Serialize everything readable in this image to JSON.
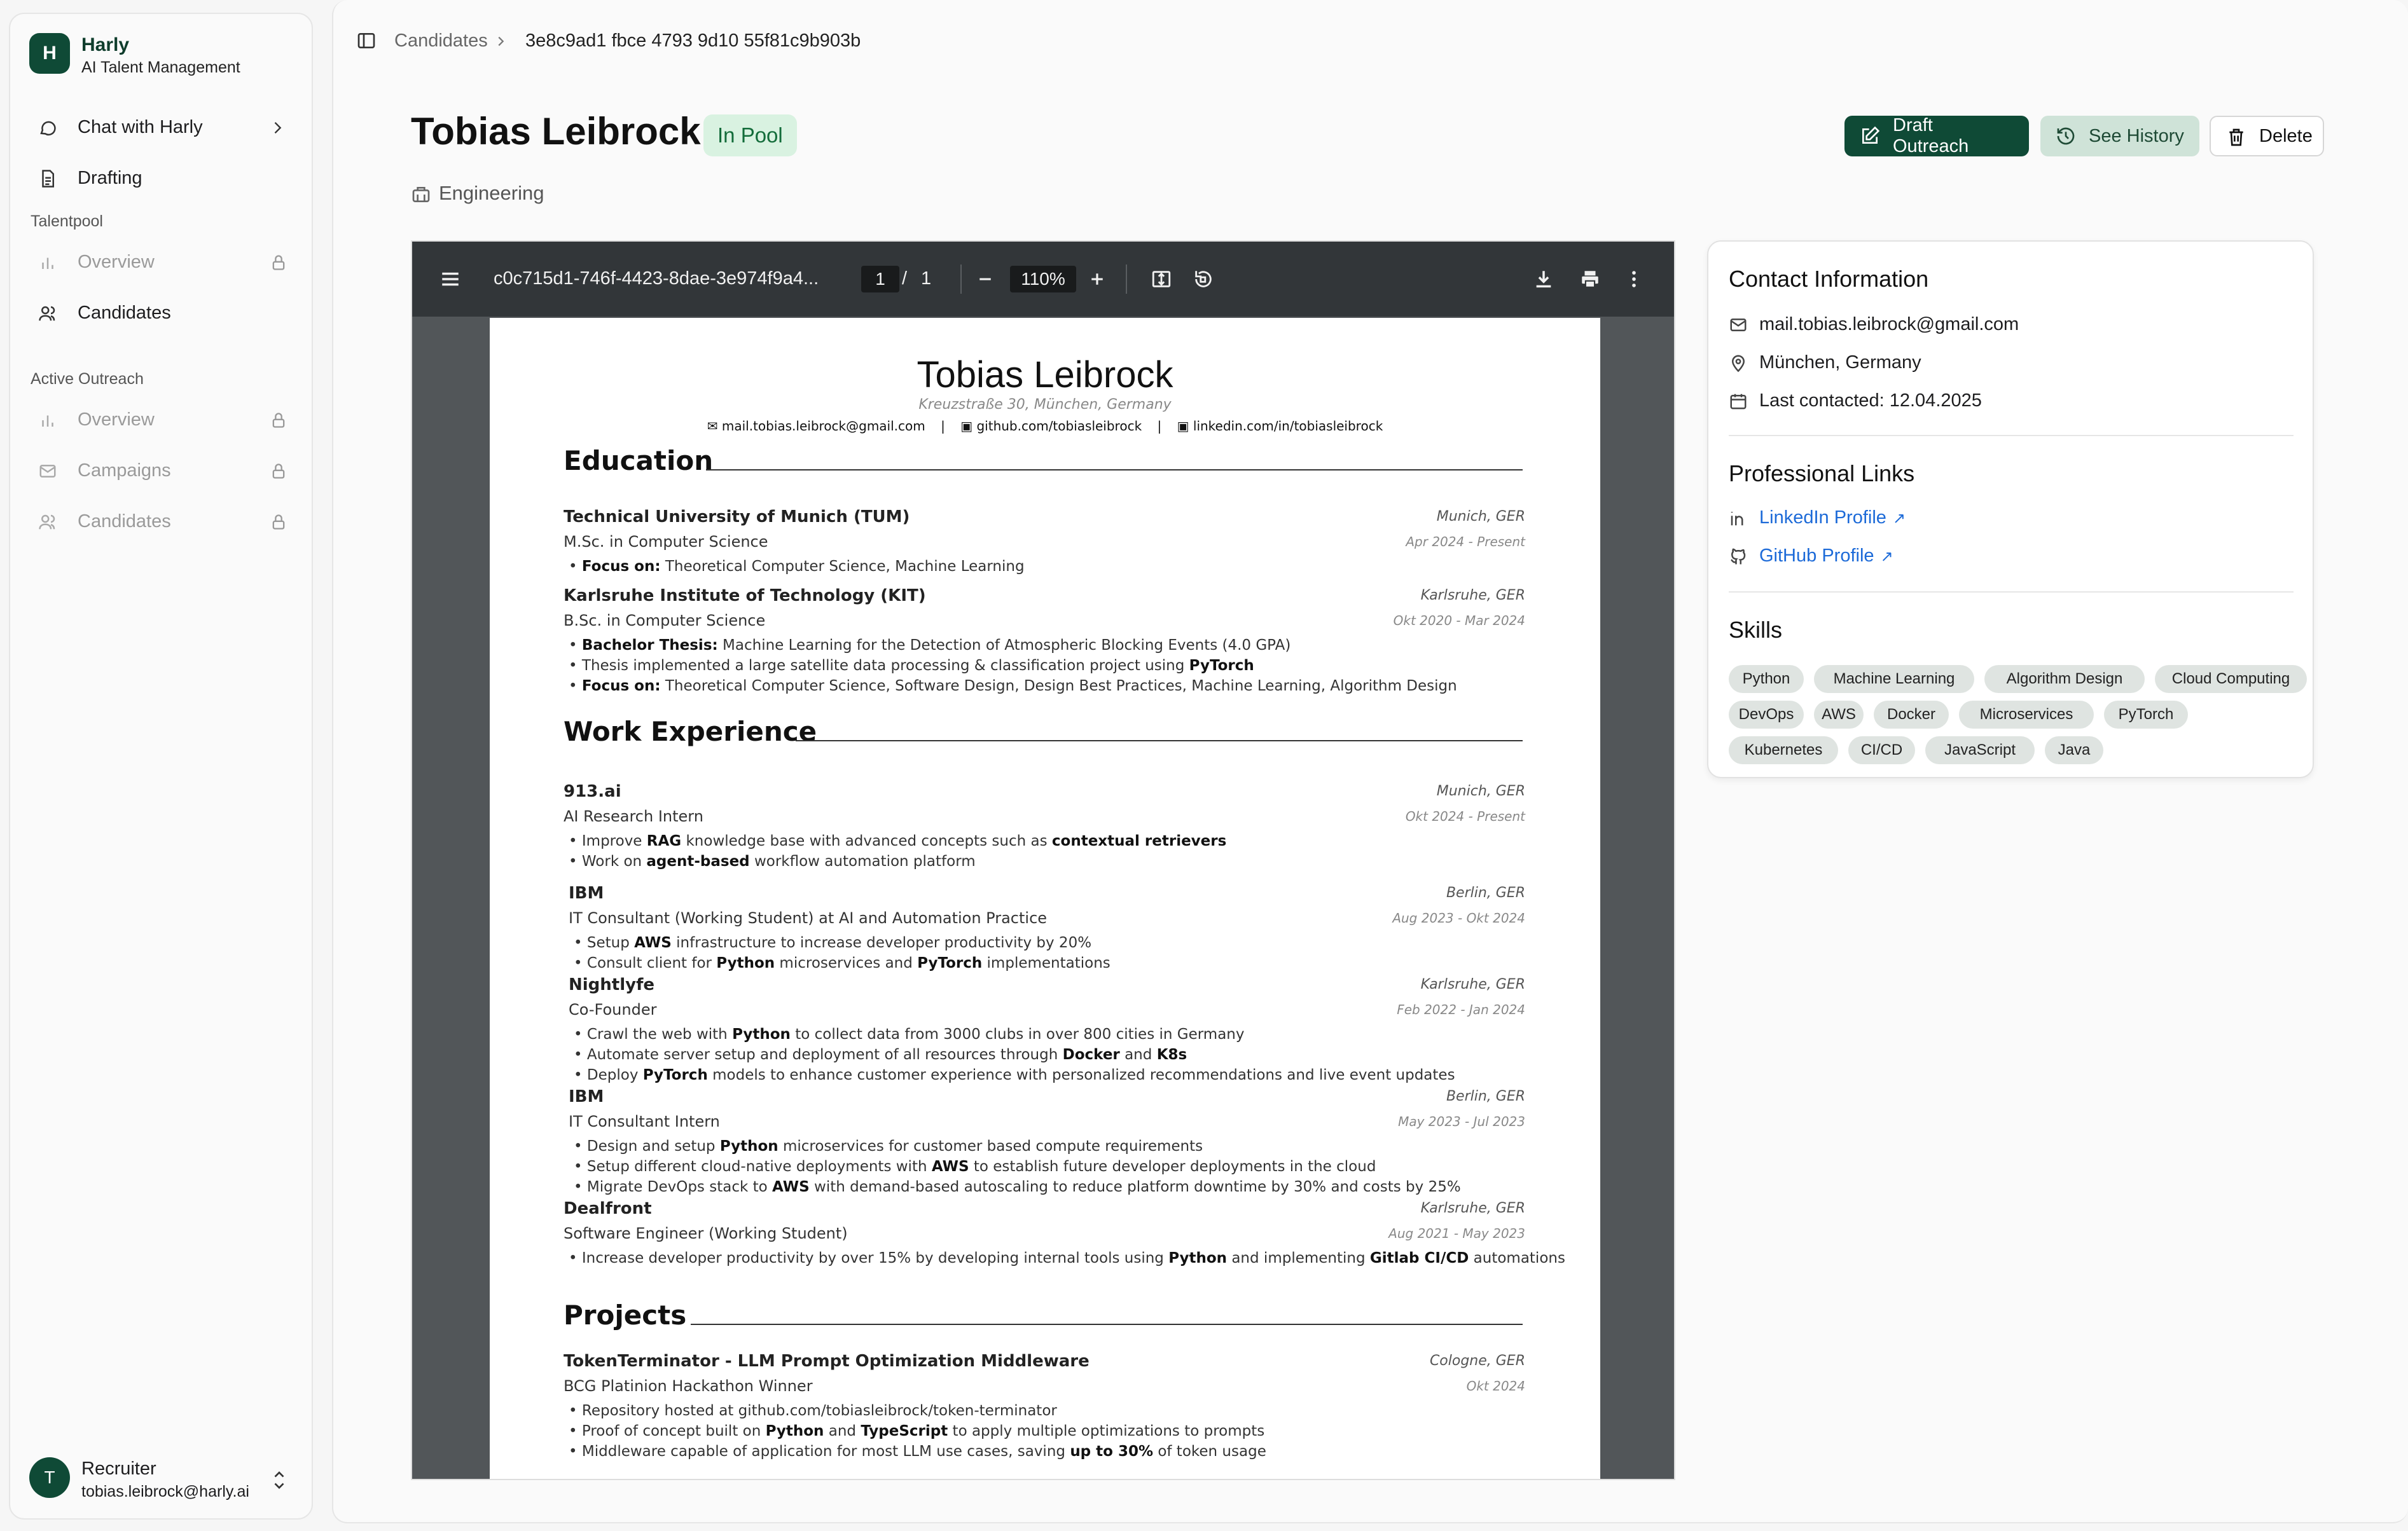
{
  "sidebar": {
    "brand": {
      "logo_letter": "H",
      "name": "Harly",
      "subtitle": "AI Talent Management"
    },
    "nav_top": [
      {
        "label": "Chat with Harly",
        "icon": "chat-icon"
      },
      {
        "label": "Drafting",
        "icon": "document-icon"
      }
    ],
    "sections": [
      {
        "title": "Talentpool",
        "items": [
          {
            "label": "Overview",
            "locked": true
          },
          {
            "label": "Candidates",
            "locked": false
          }
        ]
      },
      {
        "title": "Active Outreach",
        "items": [
          {
            "label": "Overview",
            "locked": true
          },
          {
            "label": "Campaigns",
            "locked": true
          },
          {
            "label": "Candidates",
            "locked": true
          }
        ]
      }
    ],
    "user": {
      "initial": "T",
      "name": "Recruiter",
      "email": "tobias.leibrock@harly.ai"
    }
  },
  "header": {
    "breadcrumb": [
      "Candidates",
      "3e8c9ad1 fbce 4793 9d10 55f81c9b903b"
    ],
    "title": "Tobias Leibrock",
    "status": "In Pool",
    "department": "Engineering",
    "actions": {
      "draft": "Draft Outreach",
      "history": "See History",
      "delete": "Delete"
    }
  },
  "viewer": {
    "filename": "c0c715d1-746f-4423-8dae-3e974f9a4...",
    "page_current": "1",
    "page_sep": "/",
    "page_total": "1",
    "zoom": "110%"
  },
  "resume": {
    "name": "Tobias Leibrock",
    "address": "Kreuzstraße 30, München, Germany",
    "email": "mail.tobias.leibrock@gmail.com",
    "github": "github.com/tobiasleibrock",
    "linkedin": "linkedin.com/in/tobiasleibrock",
    "sep": "|",
    "education_title": "Education",
    "education": [
      {
        "org": "Technical University of Munich (TUM)",
        "loc": "Munich, GER",
        "role": "M.Sc. in Computer Science",
        "date": "Apr 2024 - Present",
        "bullets": [
          {
            "b": "Focus on:",
            "t": " Theoretical Computer Science, Machine Learning"
          }
        ]
      },
      {
        "org": "Karlsruhe Institute of Technology (KIT)",
        "loc": "Karlsruhe, GER",
        "role": "B.Sc. in Computer Science",
        "date": "Okt 2020 - Mar 2024",
        "bullets": [
          {
            "b": "Bachelor Thesis:",
            "t": " Machine Learning for the Detection of Atmospheric Blocking Events (4.0 GPA)"
          },
          {
            "b": "",
            "t": "Thesis implemented a large satellite data processing & classification project using ",
            "b2": "PyTorch"
          },
          {
            "b": "Focus on:",
            "t": " Theoretical Computer Science, Software Design, Design Best Practices, Machine Learning, Algorithm Design"
          }
        ]
      }
    ],
    "work_title": "Work Experience",
    "work": [
      {
        "org": "913.ai",
        "loc": "Munich, GER",
        "role": "AI Research Intern",
        "date": "Okt 2024 - Present",
        "lines": [
          [
            "Improve ",
            "RAG",
            " knowledge base with advanced concepts such as ",
            "contextual retrievers",
            ""
          ],
          [
            "Work on ",
            "agent-based",
            " workflow automation platform",
            "",
            ""
          ]
        ]
      },
      {
        "org": "IBM",
        "loc": "Berlin, GER",
        "role": "IT Consultant (Working Student) at AI and Automation Practice",
        "date": "Aug 2023 - Okt 2024",
        "lines": [
          [
            "Setup ",
            "AWS",
            " infrastructure to increase developer productivity by 20%",
            "",
            ""
          ],
          [
            "Consult client for ",
            "Python",
            " microservices and ",
            "PyTorch",
            " implementations"
          ]
        ]
      },
      {
        "org": "Nightlyfe",
        "loc": "Karlsruhe, GER",
        "role": "Co-Founder",
        "date": "Feb 2022 - Jan 2024",
        "lines": [
          [
            "Crawl the web with ",
            "Python",
            " to collect data from 3000 clubs in over 800 cities in Germany",
            "",
            ""
          ],
          [
            "Automate server setup and deployment of all resources through ",
            "Docker",
            " and ",
            "K8s",
            ""
          ],
          [
            "Deploy ",
            "PyTorch",
            " models to enhance customer experience with personalized recommendations and live event updates",
            "",
            ""
          ]
        ]
      },
      {
        "org": "IBM",
        "loc": "Berlin, GER",
        "role": "IT Consultant Intern",
        "date": "May 2023 - Jul 2023",
        "lines": [
          [
            "Design and setup ",
            "Python",
            " microservices for customer based compute requirements",
            "",
            ""
          ],
          [
            "Setup different cloud-native deployments with ",
            "AWS",
            " to establish future developer deployments in the cloud",
            "",
            ""
          ],
          [
            "Migrate DevOps stack to ",
            "AWS",
            " with demand-based autoscaling to reduce platform downtime by 30% and costs by 25%",
            "",
            ""
          ]
        ]
      },
      {
        "org": "Dealfront",
        "loc": "Karlsruhe, GER",
        "role": "Software Engineer (Working Student)",
        "date": "Aug 2021 - May 2023",
        "lines": [
          [
            "Increase developer productivity by over 15% by developing internal tools using ",
            "Python",
            " and implementing ",
            "Gitlab CI/CD",
            " automations"
          ]
        ]
      }
    ],
    "projects_title": "Projects",
    "projects": [
      {
        "org": "TokenTerminator - LLM Prompt Optimization Middleware",
        "loc": "Cologne, GER",
        "role": "BCG Platinion Hackathon Winner",
        "date": "Okt 2024",
        "lines": [
          [
            "Repository hosted at github.com/tobiasleibrock/token-terminator",
            "",
            "",
            "",
            ""
          ],
          [
            "Proof of concept built on ",
            "Python",
            " and ",
            "TypeScript",
            " to apply multiple optimizations to prompts"
          ],
          [
            "Middleware capable of application for most LLM use cases, saving ",
            "up to 30%",
            " of token usage",
            "",
            ""
          ]
        ]
      }
    ]
  },
  "contact": {
    "title": "Contact Information",
    "email": "mail.tobias.leibrock@gmail.com",
    "location": "München, Germany",
    "last_contacted": "Last contacted: 12.04.2025",
    "links_title": "Professional Links",
    "linkedin": "LinkedIn Profile",
    "github": "GitHub Profile",
    "skills_title": "Skills",
    "skills": [
      "Python",
      "Machine Learning",
      "Algorithm Design",
      "Cloud Computing",
      "DevOps",
      "AWS",
      "Docker",
      "Microservices",
      "PyTorch",
      "Kubernetes",
      "CI/CD",
      "JavaScript",
      "Java"
    ]
  },
  "colors": {
    "brand": "#0f4a36",
    "status_bg": "#d9f2e1",
    "status_fg": "#136c3a",
    "link": "#1c6ad8",
    "viewer_toolbar": "#323639",
    "viewer_bg": "#525659"
  }
}
